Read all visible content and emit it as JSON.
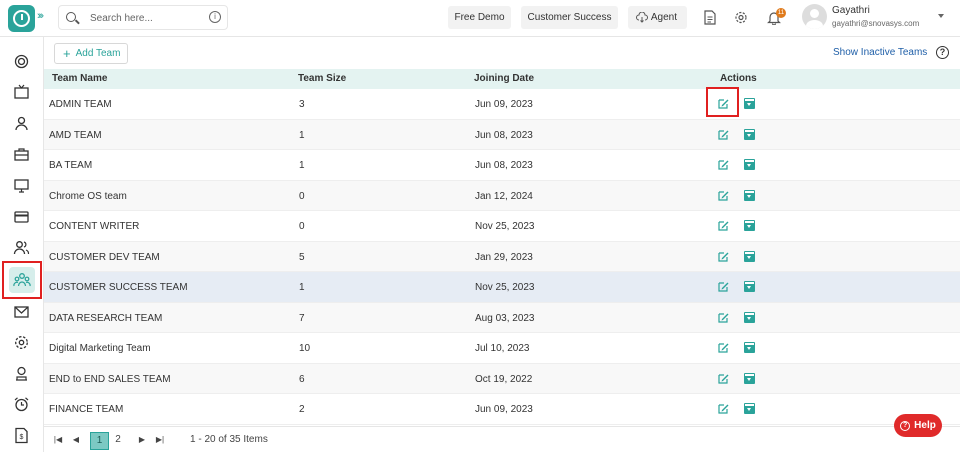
{
  "topbar": {
    "search_placeholder": "Search here...",
    "buttons": [
      "Free Demo",
      "Customer Success",
      "Agent"
    ],
    "notification_count": "11",
    "user_name": "Gayathri",
    "user_email": "gayathri@snovasys.com"
  },
  "toolbar": {
    "add_team": "Add Team",
    "show_inactive": "Show Inactive Teams"
  },
  "table": {
    "columns": [
      "Team Name",
      "Team Size",
      "Joining Date",
      "Actions"
    ],
    "rows": [
      {
        "name": "ADMIN TEAM",
        "size": "3",
        "date": "Jun 09, 2023"
      },
      {
        "name": "AMD TEAM",
        "size": "1",
        "date": "Jun 08, 2023"
      },
      {
        "name": "BA TEAM",
        "size": "1",
        "date": "Jun 08, 2023"
      },
      {
        "name": "Chrome OS team",
        "size": "0",
        "date": "Jan 12, 2024"
      },
      {
        "name": "CONTENT WRITER",
        "size": "0",
        "date": "Nov 25, 2023"
      },
      {
        "name": "CUSTOMER DEV TEAM",
        "size": "5",
        "date": "Jan 29, 2023"
      },
      {
        "name": "CUSTOMER SUCCESS TEAM",
        "size": "1",
        "date": "Nov 25, 2023"
      },
      {
        "name": "DATA RESEARCH TEAM",
        "size": "7",
        "date": "Aug 03, 2023"
      },
      {
        "name": "Digital Marketing Team",
        "size": "10",
        "date": "Jul 10, 2023"
      },
      {
        "name": "END to END SALES TEAM",
        "size": "6",
        "date": "Oct 19, 2022"
      },
      {
        "name": "FINANCE TEAM",
        "size": "2",
        "date": "Jun 09, 2023"
      }
    ]
  },
  "pager": {
    "pages": [
      "1",
      "2"
    ],
    "info": "1 - 20 of 35 Items"
  },
  "help_label": "Help",
  "colors": {
    "accent": "#2aa39a",
    "highlight": "#e02020"
  }
}
